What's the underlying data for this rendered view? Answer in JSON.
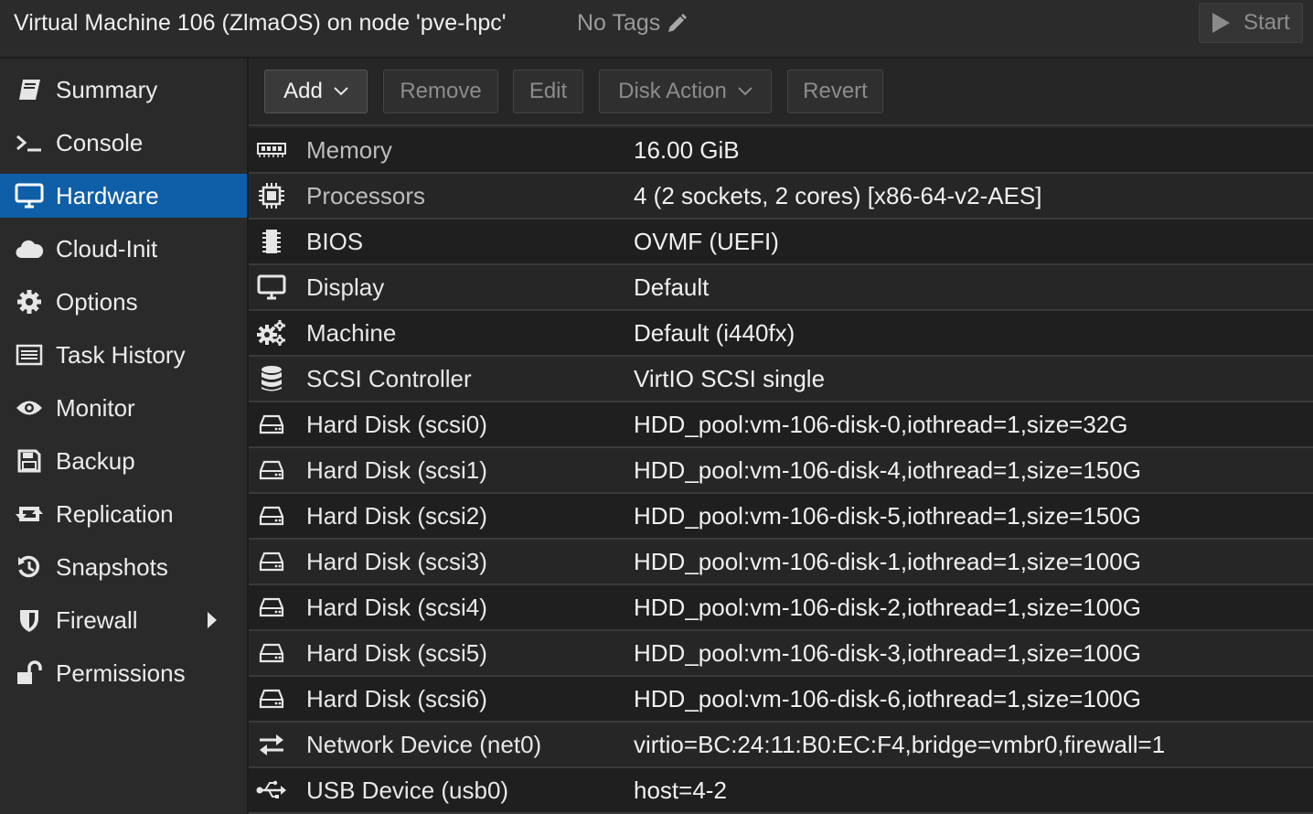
{
  "header": {
    "title": "Virtual Machine 106 (ZlmaOS) on node 'pve-hpc'",
    "tags": "No Tags",
    "start_label": "Start"
  },
  "sidebar": {
    "items": [
      {
        "label": "Summary",
        "icon": "book-icon"
      },
      {
        "label": "Console",
        "icon": "terminal-icon"
      },
      {
        "label": "Hardware",
        "icon": "monitor-icon",
        "active": true
      },
      {
        "label": "Cloud-Init",
        "icon": "cloud-icon"
      },
      {
        "label": "Options",
        "icon": "gear-icon"
      },
      {
        "label": "Task History",
        "icon": "list-icon"
      },
      {
        "label": "Monitor",
        "icon": "eye-icon"
      },
      {
        "label": "Backup",
        "icon": "floppy-icon"
      },
      {
        "label": "Replication",
        "icon": "retweet-icon"
      },
      {
        "label": "Snapshots",
        "icon": "history-icon"
      },
      {
        "label": "Firewall",
        "icon": "shield-icon",
        "expandable": true
      },
      {
        "label": "Permissions",
        "icon": "unlock-icon"
      }
    ]
  },
  "toolbar": {
    "add": "Add",
    "remove": "Remove",
    "edit": "Edit",
    "disk_action": "Disk Action",
    "revert": "Revert"
  },
  "hardware": [
    {
      "name": "Memory",
      "value": "16.00 GiB",
      "icon": "memory-icon"
    },
    {
      "name": "Processors",
      "value": "4 (2 sockets, 2 cores) [x86-64-v2-AES]",
      "icon": "cpu-icon"
    },
    {
      "name": "BIOS",
      "value": "OVMF (UEFI)",
      "icon": "microchip-icon"
    },
    {
      "name": "Display",
      "value": "Default",
      "icon": "desktop-icon"
    },
    {
      "name": "Machine",
      "value": "Default (i440fx)",
      "icon": "cogs-icon"
    },
    {
      "name": "SCSI Controller",
      "value": "VirtIO SCSI single",
      "icon": "database-icon"
    },
    {
      "name": "Hard Disk (scsi0)",
      "value": "HDD_pool:vm-106-disk-0,iothread=1,size=32G",
      "icon": "hdd-icon"
    },
    {
      "name": "Hard Disk (scsi1)",
      "value": "HDD_pool:vm-106-disk-4,iothread=1,size=150G",
      "icon": "hdd-icon"
    },
    {
      "name": "Hard Disk (scsi2)",
      "value": "HDD_pool:vm-106-disk-5,iothread=1,size=150G",
      "icon": "hdd-icon"
    },
    {
      "name": "Hard Disk (scsi3)",
      "value": "HDD_pool:vm-106-disk-1,iothread=1,size=100G",
      "icon": "hdd-icon"
    },
    {
      "name": "Hard Disk (scsi4)",
      "value": "HDD_pool:vm-106-disk-2,iothread=1,size=100G",
      "icon": "hdd-icon"
    },
    {
      "name": "Hard Disk (scsi5)",
      "value": "HDD_pool:vm-106-disk-3,iothread=1,size=100G",
      "icon": "hdd-icon"
    },
    {
      "name": "Hard Disk (scsi6)",
      "value": "HDD_pool:vm-106-disk-6,iothread=1,size=100G",
      "icon": "hdd-icon"
    },
    {
      "name": "Network Device (net0)",
      "value": "virtio=BC:24:11:B0:EC:F4,bridge=vmbr0,firewall=1",
      "icon": "exchange-icon"
    },
    {
      "name": "USB Device (usb0)",
      "value": "host=4-2",
      "icon": "usb-icon"
    }
  ]
}
